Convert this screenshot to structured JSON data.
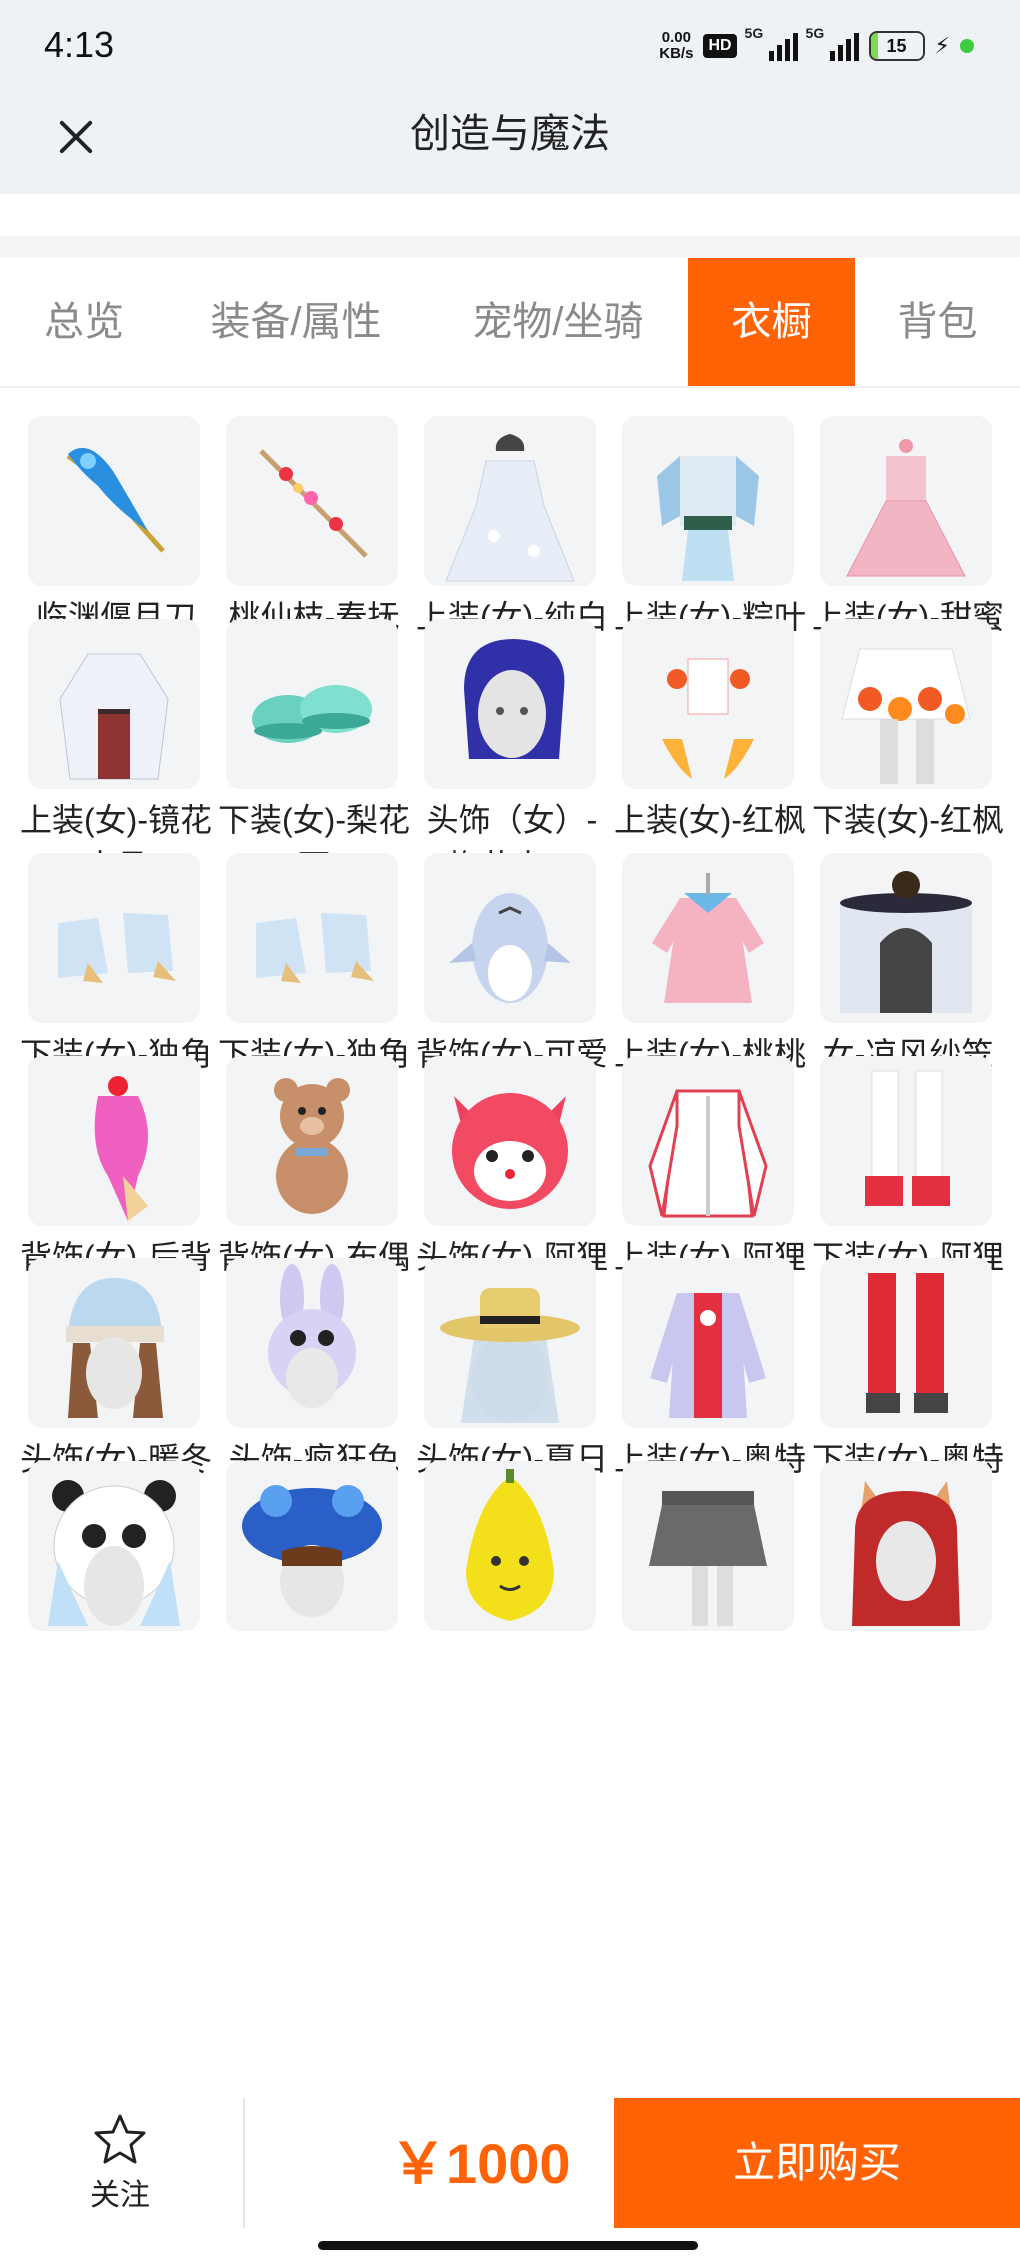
{
  "status_bar": {
    "time": "4:13",
    "net_speed": "0.00",
    "net_unit": "KB/s",
    "hd": "HD",
    "sim1": "5G",
    "sim2": "5G",
    "battery": "15",
    "battery_level": 0.15
  },
  "header": {
    "title": "创造与魔法",
    "close_icon": "close-icon"
  },
  "tabs": [
    {
      "label": "总览",
      "active": false
    },
    {
      "label": "装备/属性",
      "active": false
    },
    {
      "label": "宠物/坐骑",
      "active": false
    },
    {
      "label": "衣橱",
      "active": true
    },
    {
      "label": "背包",
      "active": false
    }
  ],
  "items": [
    {
      "label": "临渊偃月刀",
      "icon": "blade-icon"
    },
    {
      "label": "桃仙枝-春抚",
      "icon": "branch-icon"
    },
    {
      "label": "上装(女)-纯白",
      "icon": "white-dress-icon"
    },
    {
      "label": "上装(女)-粽叶青青",
      "icon": "green-outfit-icon"
    },
    {
      "label": "上装(女)-甜蜜蜜",
      "icon": "pink-dress-icon"
    },
    {
      "label": "上装(女)-镜花水月",
      "icon": "robe-icon"
    },
    {
      "label": "下装(女)-梨花雨",
      "icon": "shoes-icon"
    },
    {
      "label": "头饰（女）-梅花十三",
      "icon": "hair-icon"
    },
    {
      "label": "上装(女)-红枫",
      "icon": "maple-top-icon"
    },
    {
      "label": "下装(女)-红枫",
      "icon": "maple-skirt-icon"
    },
    {
      "label": "下装(女)-独角兽",
      "icon": "unicorn-boots-icon"
    },
    {
      "label": "下装(女)-独角兽",
      "icon": "unicorn-boots-icon"
    },
    {
      "label": "背饰(女)-可爱鲨鱼",
      "icon": "shark-icon"
    },
    {
      "label": "上装(女)-桃桃兔",
      "icon": "bunny-top-icon"
    },
    {
      "label": "女-凉风纱笠",
      "icon": "veil-hat-icon"
    },
    {
      "label": "背饰(女)-后背一凉",
      "icon": "ice-cream-icon"
    },
    {
      "label": "背饰(女)-布偶熊",
      "icon": "teddy-bear-icon"
    },
    {
      "label": "头饰(女)-阿狸",
      "icon": "fox-head-icon"
    },
    {
      "label": "上装(女)-阿狸萌趣",
      "icon": "jacket-icon"
    },
    {
      "label": "下装(女)-阿狸萌趣",
      "icon": "boots-icon"
    },
    {
      "label": "头饰(女)-暖冬绒线帽",
      "icon": "knit-hat-icon"
    },
    {
      "label": "头饰-疯狂兔子",
      "icon": "rabbit-hat-icon"
    },
    {
      "label": "头饰(女)-夏日草帽",
      "icon": "straw-hat-icon"
    },
    {
      "label": "上装(女)-奥特之母",
      "icon": "hero-top-icon"
    },
    {
      "label": "下装(女)-奥特之母",
      "icon": "red-boots-icon"
    },
    {
      "label": "",
      "icon": "panda-hat-icon"
    },
    {
      "label": "",
      "icon": "octopus-hat-icon"
    },
    {
      "label": "",
      "icon": "banana-icon"
    },
    {
      "label": "",
      "icon": "grey-skirt-icon"
    },
    {
      "label": "",
      "icon": "fox-ear-hair-icon"
    }
  ],
  "bottom": {
    "fav_label": "关注",
    "fav_icon": "star-icon",
    "price": "￥1000",
    "buy_label": "立即购买"
  },
  "colors": {
    "accent": "#ff6306",
    "tile_bg": "#f3f4f6",
    "header_bg": "#eef2f6"
  }
}
